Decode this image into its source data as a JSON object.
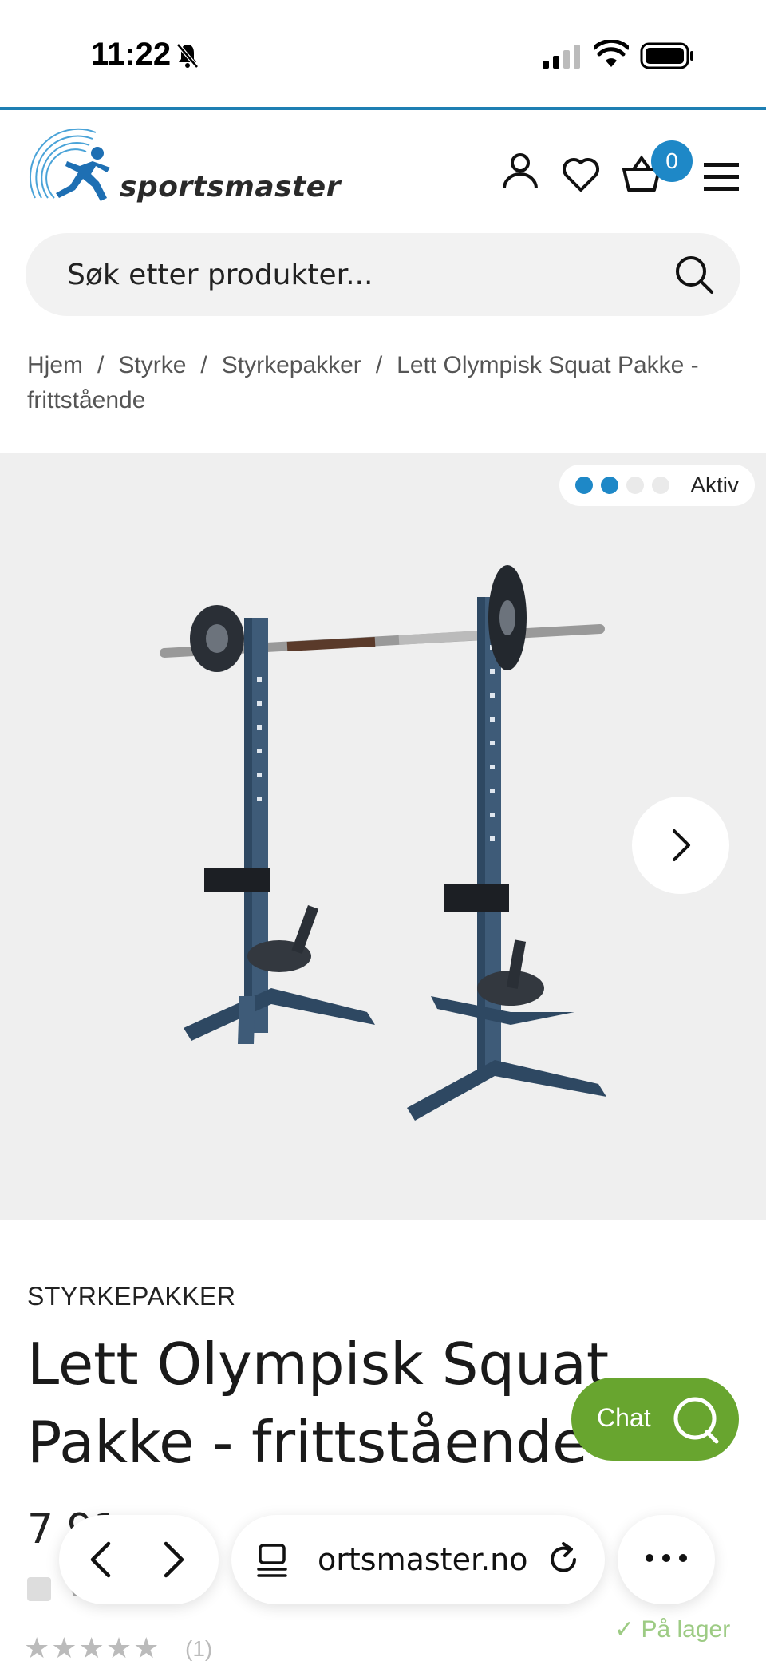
{
  "status_bar": {
    "time": "11:22"
  },
  "header": {
    "logo_text": "sportsmaster",
    "cart_count": "0"
  },
  "search": {
    "placeholder": "Søk etter produkter..."
  },
  "breadcrumb": {
    "items": [
      "Hjem",
      "Styrke",
      "Styrkepakker",
      "Lett Olympisk Squat Pakke - frittstående"
    ],
    "separator": "/"
  },
  "gallery": {
    "badge_label": "Aktiv",
    "active_dots": 2,
    "total_dots": 4
  },
  "product": {
    "category": "STYRKEPAKKER",
    "title": "Lett Olympisk Squat Pakke - frittstående",
    "price_partial": "7 91",
    "variant_label": "V  ...  a",
    "rating_stars": "★★★★★",
    "review_count": "(1)",
    "stock_status": "✓ På lager"
  },
  "chat": {
    "label": "Chat"
  },
  "browser": {
    "url": "ortsmaster.no"
  },
  "colors": {
    "brand_blue": "#1e88c7",
    "chat_green": "#68a52f",
    "hero_bg": "#efefef"
  }
}
